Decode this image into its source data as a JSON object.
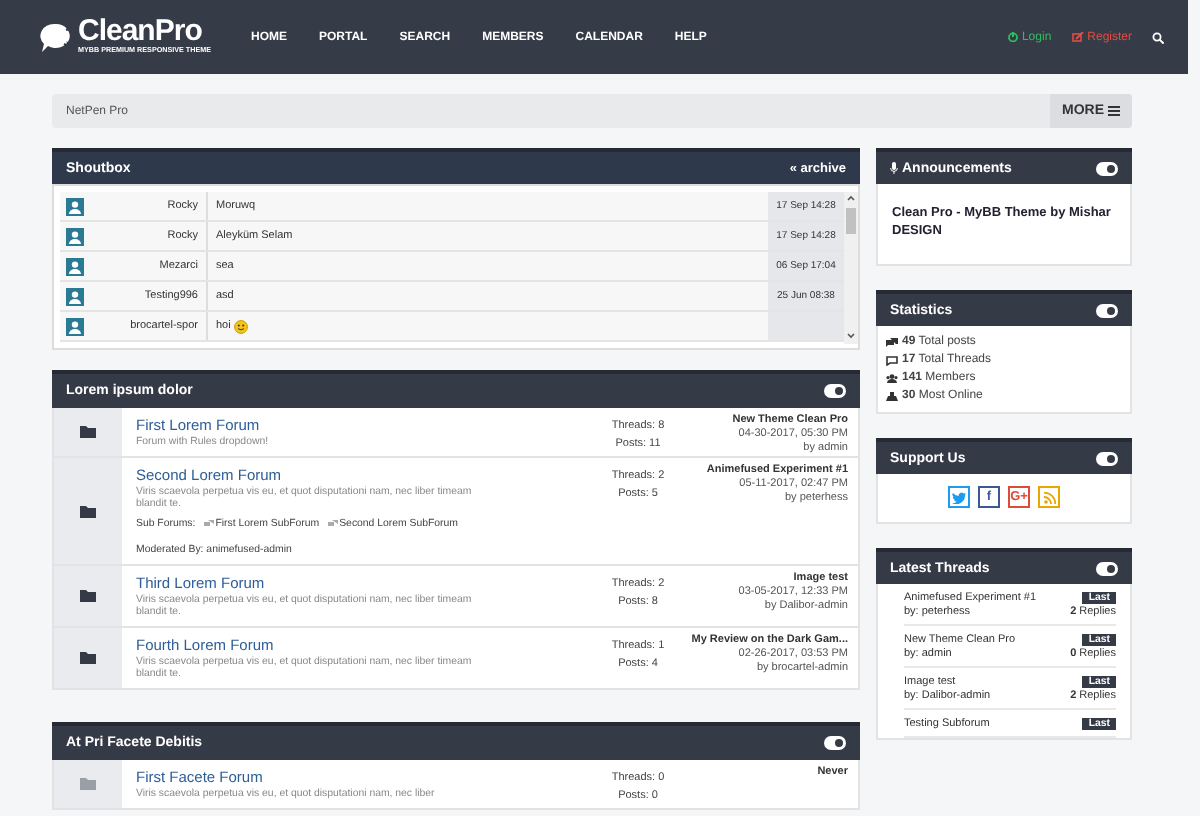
{
  "header": {
    "logo": {
      "title": "CleanPro",
      "tagline": "MYBB PREMIUM RESPONSIVE THEME"
    },
    "nav": [
      "HOME",
      "PORTAL",
      "SEARCH",
      "MEMBERS",
      "CALENDAR",
      "HELP"
    ],
    "user_links": [
      {
        "kind": "login",
        "label": "Login"
      },
      {
        "kind": "register",
        "label": "Register"
      }
    ]
  },
  "breadcrumb": {
    "text": "NetPen Pro",
    "more": "MORE"
  },
  "shoutbox": {
    "title": "Shoutbox",
    "archive": "« archive",
    "rows": [
      {
        "user": "Rocky",
        "message": "Moruwq",
        "time": "17 Sep 14:28",
        "smiley": false
      },
      {
        "user": "Rocky",
        "message": "Aleyküm Selam",
        "time": "17 Sep 14:28",
        "smiley": false
      },
      {
        "user": "Mezarci",
        "message": "sea",
        "time": "06 Sep 17:04",
        "smiley": false
      },
      {
        "user": "Testing996",
        "message": "asd",
        "time": "25 Jun 08:38",
        "smiley": false
      },
      {
        "user": "brocartel-spor",
        "message": "hoi",
        "smiley": true
      }
    ]
  },
  "categories": [
    {
      "title": "Lorem ipsum dolor",
      "forums": [
        {
          "name": "First Lorem Forum",
          "description": "Forum with Rules dropdown!",
          "threads": "Threads: 8",
          "posts": "Posts: 11",
          "last_title": "New Theme Clean Pro",
          "last_date": "04-30-2017, 05:30 PM",
          "last_by": "by admin",
          "unread": true
        },
        {
          "name": "Second Lorem Forum",
          "description": "Viris scaevola perpetua vis eu, et quot disputationi nam, nec liber timeam blandit te.",
          "subforums_label": "Sub Forums:",
          "subforums": [
            "First Lorem SubForum",
            "Second Lorem SubForum"
          ],
          "moderated": "Moderated By: animefused-admin",
          "threads": "Threads: 2",
          "posts": "Posts: 5",
          "last_title": "Animefused Experiment #1",
          "last_date": "05-11-2017, 02:47 PM",
          "last_by": "by peterhess",
          "unread": true
        },
        {
          "name": "Third Lorem Forum",
          "description": "Viris scaevola perpetua vis eu, et quot disputationi nam, nec liber timeam blandit te.",
          "threads": "Threads: 2",
          "posts": "Posts: 8",
          "last_title": "Image test",
          "last_date": "03-05-2017, 12:33 PM",
          "last_by": "by Dalibor-admin",
          "unread": true
        },
        {
          "name": "Fourth Lorem Forum",
          "description": "Viris scaevola perpetua vis eu, et quot disputationi nam, nec liber timeam blandit te.",
          "threads": "Threads: 1",
          "posts": "Posts: 4",
          "last_title": "My Review on the Dark Gam...",
          "last_date": "02-26-2017, 03:53 PM",
          "last_by": "by brocartel-admin",
          "unread": true
        }
      ]
    },
    {
      "title": "At Pri Facete Debitis",
      "forums": [
        {
          "name": "First Facete Forum",
          "description": "Viris scaevola perpetua vis eu, et quot disputationi nam, nec liber",
          "threads": "Threads: 0",
          "posts": "Posts: 0",
          "last_title": "Never",
          "unread": false
        }
      ]
    }
  ],
  "sidebar": [
    {
      "kind": "announcements",
      "title": "Announcements",
      "text": "Clean Pro - MyBB Theme by Mishar DESIGN"
    },
    {
      "kind": "stats",
      "title": "Statistics",
      "items": [
        {
          "text": "**49** Total posts"
        },
        {
          "text": "**17** Total Threads"
        },
        {
          "text": "**141** Members"
        },
        {
          "text": "**30** Most Online"
        }
      ]
    },
    {
      "kind": "social",
      "title": "Support Us",
      "links": [
        {
          "kind": "twitter",
          "color": "#1d9bf0"
        },
        {
          "kind": "facebook",
          "glyph": "f",
          "color": "#3b5998"
        },
        {
          "kind": "google",
          "glyph": "G+",
          "color": "#dd4b39"
        },
        {
          "kind": "rss",
          "color": "#e8a800"
        }
      ]
    },
    {
      "kind": "threads",
      "title": "Latest Threads",
      "items": [
        {
          "title": "Animefused Experiment #1",
          "badge": "Last",
          "by": "by: peterhess",
          "replies": "**2** Replies"
        },
        {
          "title": "New Theme Clean Pro",
          "badge": "Last",
          "by": "by: admin",
          "replies": "**0** Replies"
        },
        {
          "title": "Image test",
          "badge": "Last",
          "by": "by: Dalibor-admin",
          "replies": "**2** Replies"
        },
        {
          "title": "Testing Subforum",
          "badge": "Last"
        }
      ]
    }
  ]
}
